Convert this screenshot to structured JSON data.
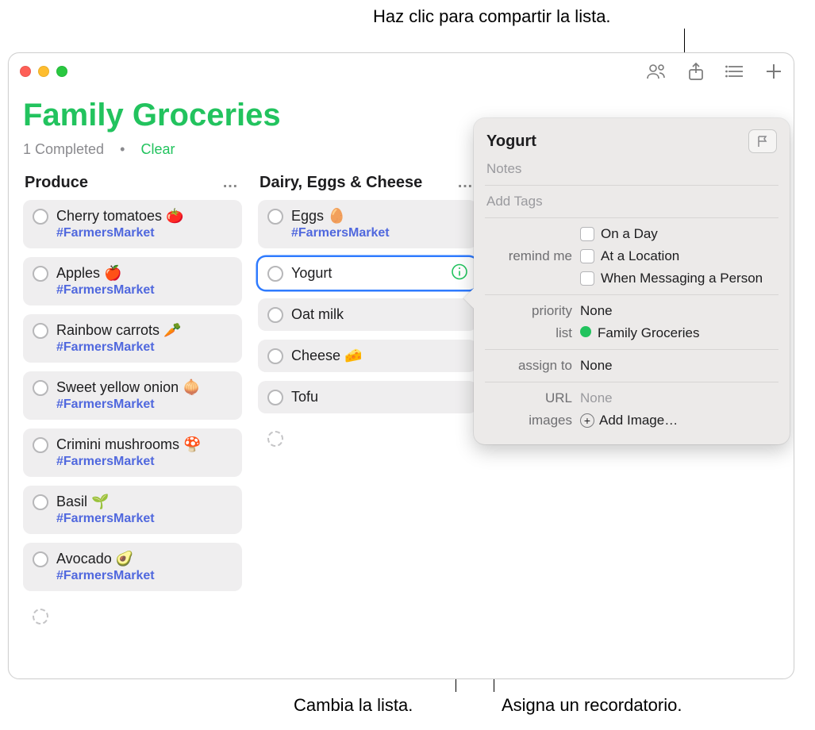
{
  "callouts": {
    "share": "Haz clic para compartir la lista.",
    "change_list": "Cambia la lista.",
    "assign": "Asigna un recordatorio."
  },
  "header": {
    "list_title": "Family Groceries",
    "completed_count": "1 Completed",
    "dot": "•",
    "clear_label": "Clear"
  },
  "columns": [
    {
      "title": "Produce",
      "more": "…",
      "items": [
        {
          "title": "Cherry tomatoes 🍅",
          "tag": "#FarmersMarket"
        },
        {
          "title": "Apples 🍎",
          "tag": "#FarmersMarket"
        },
        {
          "title": "Rainbow carrots 🥕",
          "tag": "#FarmersMarket"
        },
        {
          "title": "Sweet yellow onion 🧅",
          "tag": "#FarmersMarket"
        },
        {
          "title": "Crimini mushrooms 🍄",
          "tag": "#FarmersMarket"
        },
        {
          "title": "Basil 🌱",
          "tag": "#FarmersMarket"
        },
        {
          "title": "Avocado 🥑",
          "tag": "#FarmersMarket"
        }
      ]
    },
    {
      "title": "Dairy, Eggs & Cheese",
      "more": "…",
      "items": [
        {
          "title": "Eggs 🥚",
          "tag": "#FarmersMarket"
        },
        {
          "title": "Yogurt",
          "selected": true
        },
        {
          "title": "Oat milk"
        },
        {
          "title": "Cheese 🧀"
        },
        {
          "title": "Tofu"
        }
      ]
    }
  ],
  "popover": {
    "title": "Yogurt",
    "notes_placeholder": "Notes",
    "tags_placeholder": "Add Tags",
    "remind_me_label": "remind me",
    "remind_options": {
      "day": "On a Day",
      "location": "At a Location",
      "messaging": "When Messaging a Person"
    },
    "priority_label": "priority",
    "priority_value": "None",
    "list_label": "list",
    "list_value": "Family Groceries",
    "list_color": "#22c35e",
    "assign_label": "assign to",
    "assign_value": "None",
    "url_label": "URL",
    "url_value": "None",
    "images_label": "images",
    "add_image_label": "Add Image…"
  }
}
